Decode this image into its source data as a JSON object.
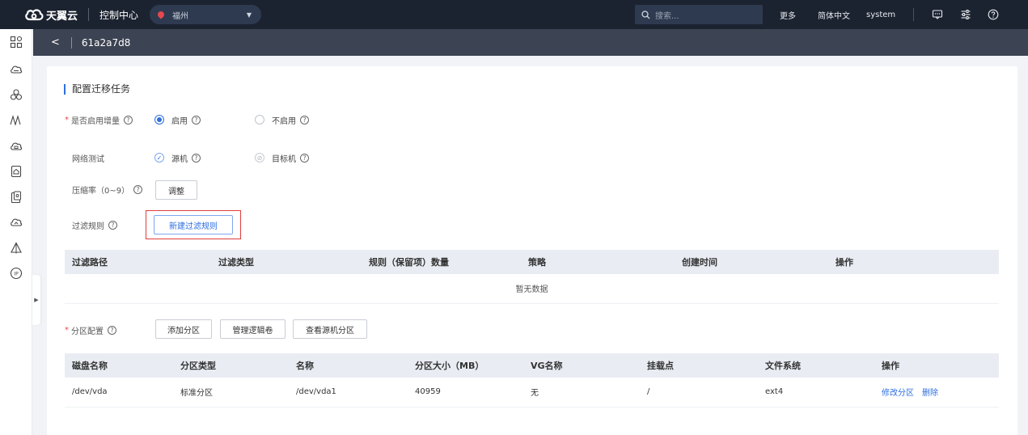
{
  "topbar": {
    "logo_text": "天翼云",
    "console_title": "控制中心",
    "region": "福州",
    "search_placeholder": "搜索...",
    "more": "更多",
    "language": "简体中文",
    "user": "system"
  },
  "subheader": {
    "title": "61a2a7d8"
  },
  "form": {
    "section_title": "配置迁移任务",
    "incremental_label": "是否启用增量",
    "incremental_on": "启用",
    "incremental_off": "不启用",
    "network_test_label": "网络测试",
    "network_source": "源机",
    "network_target": "目标机",
    "compression_label": "压缩率（0~9）",
    "compression_button": "调整",
    "filter_label": "过滤规则",
    "filter_button": "新建过滤规则",
    "partition_label": "分区配置",
    "partition_buttons": [
      "添加分区",
      "管理逻辑卷",
      "查看源机分区"
    ]
  },
  "filter_table": {
    "headers": [
      "过滤路径",
      "过滤类型",
      "规则（保留项）数量",
      "策略",
      "创建时间",
      "操作"
    ],
    "empty_text": "暂无数据"
  },
  "partition_table": {
    "headers": [
      "磁盘名称",
      "分区类型",
      "名称",
      "分区大小（MB）",
      "VG名称",
      "挂载点",
      "文件系统",
      "操作"
    ],
    "rows": [
      {
        "disk": "/dev/vda",
        "type": "标准分区",
        "name": "/dev/vda1",
        "size": "40959",
        "vg": "无",
        "mount": "/",
        "fs": "ext4",
        "action_edit": "修改分区",
        "action_delete": "删除"
      }
    ]
  },
  "icons": {
    "rail": [
      "dashboard-icon",
      "cloud-host-icon",
      "network-icon",
      "monitor-icon",
      "storage-icon",
      "database-icon",
      "server-icon",
      "cdn-icon",
      "security-icon",
      "ip-icon"
    ],
    "topbar": [
      "message-icon",
      "settings-icon",
      "help-icon"
    ]
  },
  "colors": {
    "topbar_bg": "#1c2330",
    "subheader_bg": "#3c4352",
    "accent": "#2d6fe0",
    "highlight": "#e03c3c",
    "required": "#e5484d"
  }
}
